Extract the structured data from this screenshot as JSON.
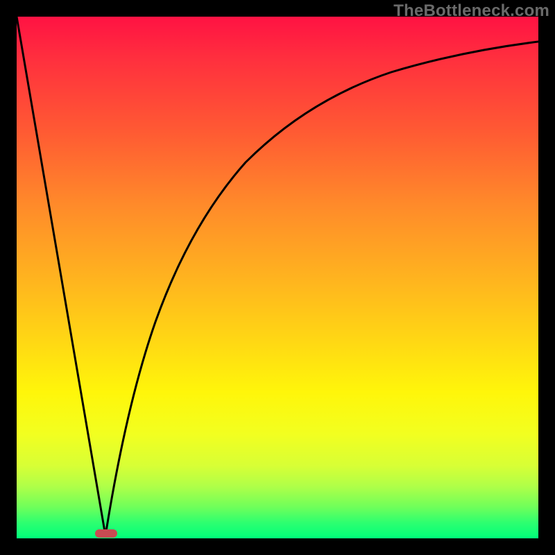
{
  "watermark": "TheBottleneck.com",
  "colors": {
    "frame": "#000000",
    "curve": "#000000",
    "marker": "#c84b52",
    "gradient_top": "#ff1243",
    "gradient_bottom": "#00ff7a"
  },
  "chart_data": {
    "type": "line",
    "title": "",
    "xlabel": "",
    "ylabel": "",
    "xlim": [
      0,
      100
    ],
    "ylim": [
      0,
      100
    ],
    "grid": false,
    "legend": false,
    "series": [
      {
        "name": "left-linear-segment",
        "x": [
          0,
          17
        ],
        "y": [
          100,
          0
        ]
      },
      {
        "name": "right-log-curve",
        "x": [
          17,
          20,
          24,
          28,
          33,
          40,
          48,
          58,
          70,
          84,
          100
        ],
        "y": [
          0,
          18,
          35,
          47,
          57,
          66,
          73,
          79,
          84,
          88,
          91
        ]
      }
    ],
    "annotations": [
      {
        "name": "vertex-marker",
        "shape": "rounded-rect",
        "x": 17,
        "y": 0,
        "width_pct": 4,
        "height_pct": 1.5,
        "color": "#c84b52"
      }
    ]
  }
}
